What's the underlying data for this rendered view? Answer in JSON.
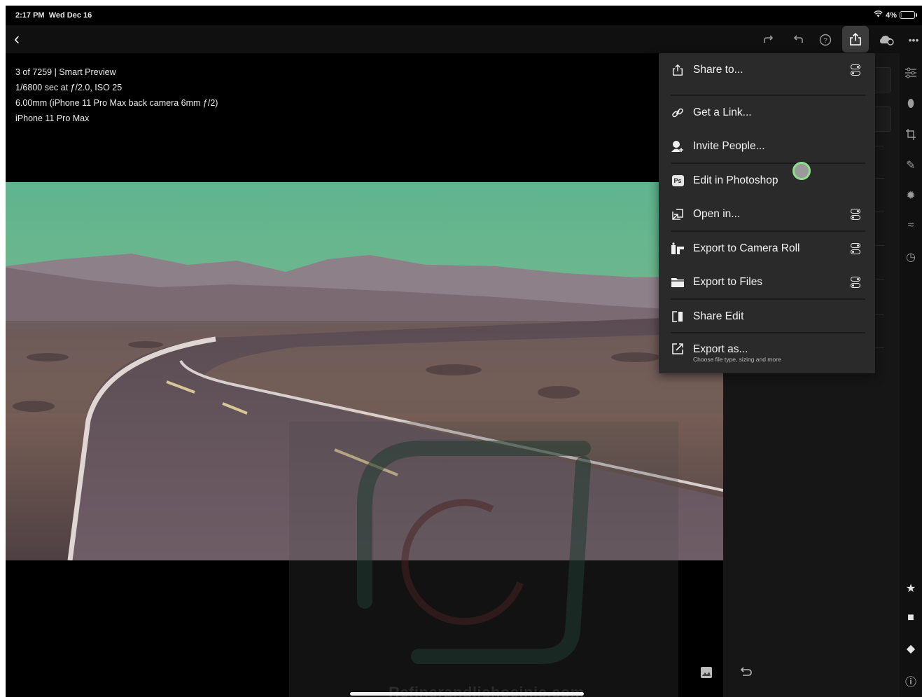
{
  "status_bar": {
    "time": "2:17 PM",
    "date": "Wed Dec 16",
    "battery": "4%",
    "battery_level": 0.04
  },
  "top_bar": {
    "back_icon": "chevron-left-icon",
    "icons": [
      "redo-icon",
      "undo-icon",
      "help-icon",
      "share-icon",
      "cloud-sync-icon",
      "more-icon"
    ]
  },
  "metadata": {
    "line1": "3 of 7259 | Smart Preview",
    "line2": "1/6800 sec at ƒ/2.0, ISO 25",
    "line3": "6.00mm (iPhone 11 Pro Max back camera 6mm ƒ/2)",
    "line4": "iPhone 11 Pro Max"
  },
  "share_menu": {
    "items": [
      {
        "label": "Share to...",
        "icon": "share-icon",
        "badge": "toggle-icon"
      },
      {
        "label": "Get a Link...",
        "icon": "link-icon",
        "badge": ""
      },
      {
        "label": "Invite People...",
        "icon": "invite-person-icon",
        "badge": ""
      },
      {
        "label": "Edit in Photoshop",
        "icon": "photoshop-icon",
        "badge": ""
      },
      {
        "label": "Open in...",
        "icon": "open-in-icon",
        "badge": "toggle-icon"
      },
      {
        "label": "Export to Camera Roll",
        "icon": "camera-roll-icon",
        "badge": "toggle-icon"
      },
      {
        "label": "Export to Files",
        "icon": "folder-icon",
        "badge": "toggle-icon"
      },
      {
        "label": "Share Edit",
        "icon": "compare-icon",
        "badge": ""
      },
      {
        "label": "Export as...",
        "icon": "export-icon",
        "badge": "",
        "sublabel": "Choose file type, sizing and more"
      }
    ]
  },
  "side_rail": {
    "icons": [
      "sliders-icon",
      "heal-icon",
      "crop-icon",
      "brush-icon",
      "detail-icon",
      "presets-icon",
      "history-icon",
      "star-icon",
      "comment-icon",
      "tag-icon",
      "info-icon"
    ]
  },
  "bottom_icons": [
    "before-after-icon",
    "reset-icon"
  ],
  "watermark": {
    "text": "Refinerandlichoeinic.com"
  },
  "colors": {
    "accent_touch": "#8de08a",
    "menu_bg": "#2a2a2a",
    "background": "#000000"
  }
}
